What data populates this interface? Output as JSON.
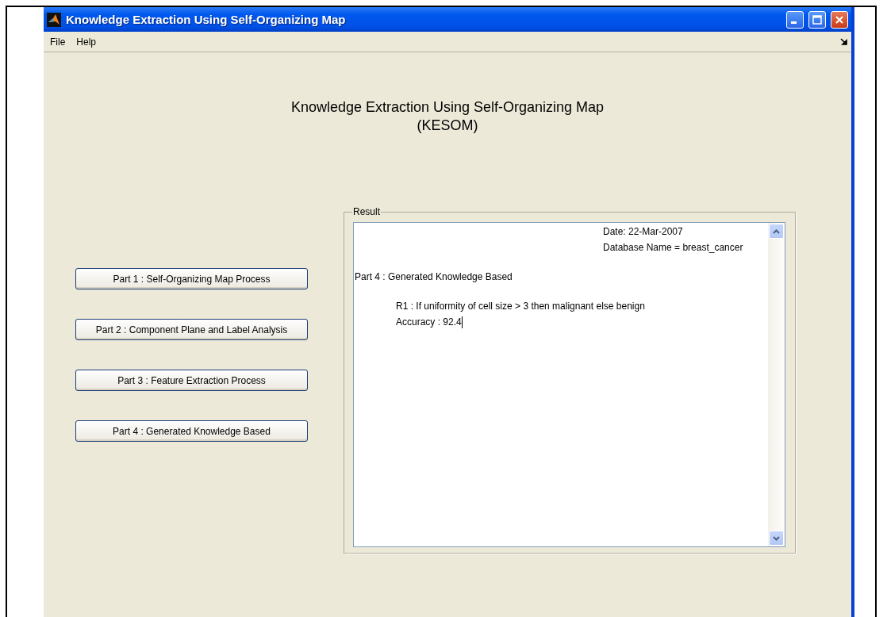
{
  "window": {
    "title": "Knowledge Extraction Using Self-Organizing Map"
  },
  "menu": [
    "File",
    "Help"
  ],
  "heading": [
    "Knowledge Extraction Using Self-Organizing Map",
    "(KESOM)"
  ],
  "buttons": [
    "Part 1 : Self-Organizing Map Process",
    "Part 2 : Component Plane and Label Analysis",
    "Part 3 : Feature Extraction Process",
    "Part 4 : Generated Knowledge Based"
  ],
  "result": {
    "title": "Result",
    "lines": [
      {
        "text": "Date: 22-Mar-2007",
        "kind": "right",
        "caret": false
      },
      {
        "text": "Database Name = breast_cancer",
        "kind": "right",
        "caret": false
      },
      {
        "text": "Part 4 : Generated Knowledge Based",
        "kind": "plain",
        "caret": false
      },
      {
        "text": "R1 : If uniformity of cell size > 3 then malignant else benign",
        "kind": "indented",
        "caret": false
      },
      {
        "text": "Accuracy : 92.4",
        "kind": "indented",
        "caret": true
      }
    ]
  }
}
